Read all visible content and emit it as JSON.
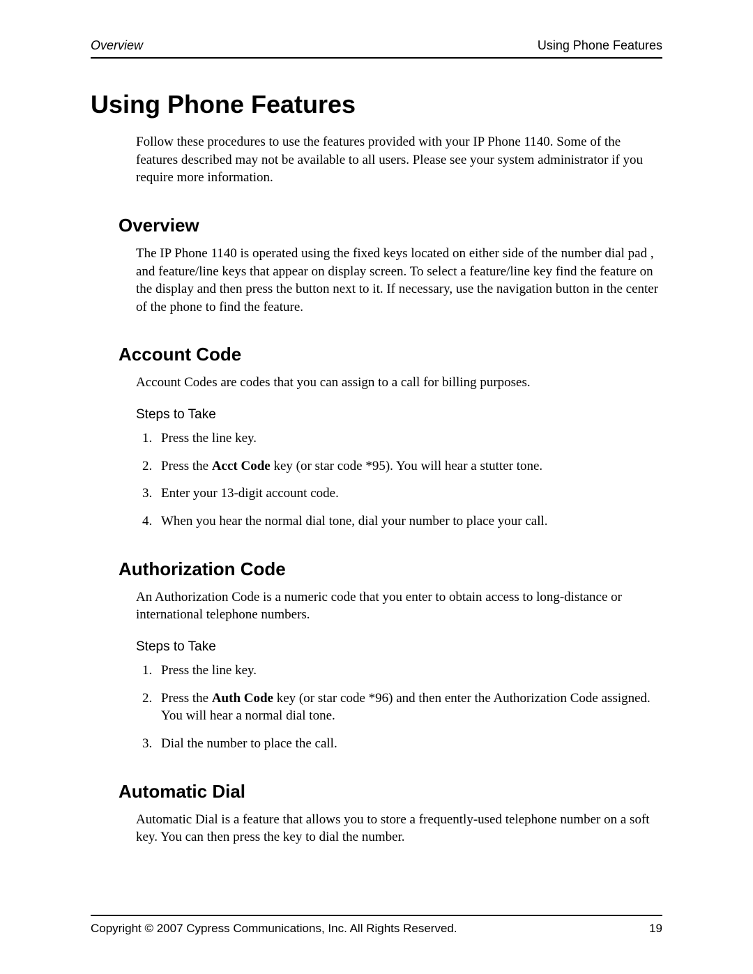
{
  "header": {
    "left": "Overview",
    "right": "Using Phone Features"
  },
  "title": "Using Phone Features",
  "intro": "Follow these procedures to use the features provided with your IP Phone 1140. Some of the features described may not be available to all users. Please see your system administrator if you require more information.",
  "overview": {
    "heading": "Overview",
    "body": "The IP Phone 1140 is operated using the fixed keys located on either side of the number dial pad , and feature/line keys that appear on display screen. To select a feature/line key find the feature on the display and then press the button next to it. If necessary, use the navigation button in the center of the phone to find the feature."
  },
  "account_code": {
    "heading": "Account Code",
    "body": "Account Codes are codes that you can assign to a call for billing purposes.",
    "steps_label": "Steps to Take",
    "steps": {
      "s1": "Press the line key.",
      "s2a": "Press the ",
      "s2b": "Acct Code",
      "s2c": " key (or star code *95). You will hear a stutter tone.",
      "s3": "Enter your 13-digit account code.",
      "s4": "When you hear the normal dial tone, dial your number to place your call."
    }
  },
  "auth_code": {
    "heading": "Authorization Code",
    "body": "An Authorization Code is a numeric code that you enter to obtain access to long-distance or international telephone numbers.",
    "steps_label": "Steps to Take",
    "steps": {
      "s1": "Press the line key.",
      "s2a": "Press the ",
      "s2b": "Auth Code",
      "s2c": " key (or star code *96) and then enter the Authorization Code assigned. You will hear a normal dial tone.",
      "s3": "Dial the number to place the call."
    }
  },
  "auto_dial": {
    "heading": "Automatic Dial",
    "body": "Automatic Dial is a feature that allows you to store a frequently-used telephone number on a soft key. You can then press the key to dial the number."
  },
  "footer": {
    "copyright": "Copyright © 2007 Cypress Communications, Inc. All Rights Reserved.",
    "page_number": "19"
  }
}
